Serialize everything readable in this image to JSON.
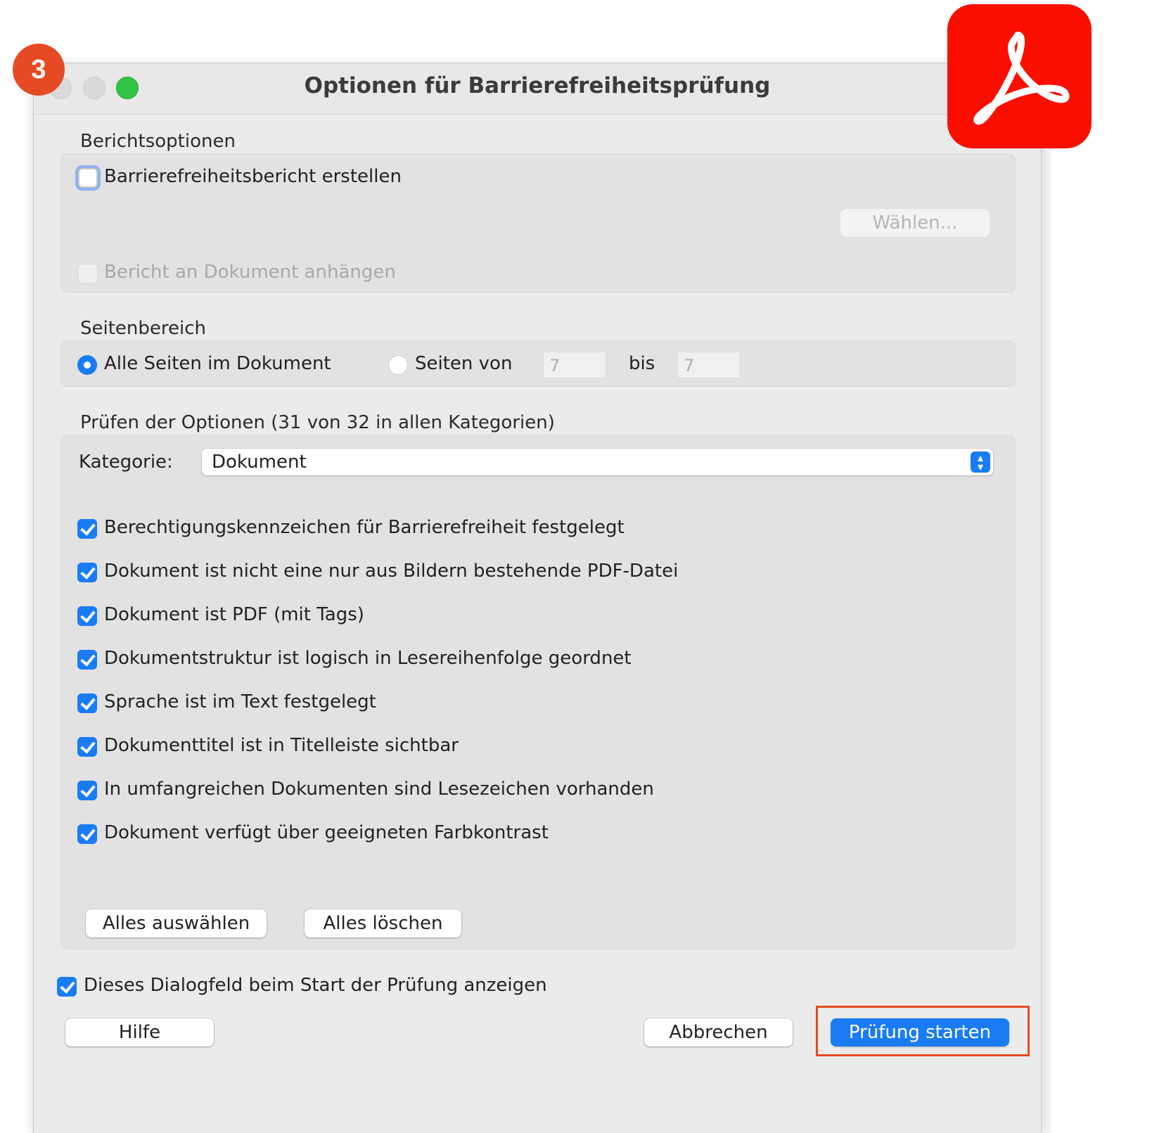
{
  "window": {
    "title": "Optionen für Barrierefreiheitsprüfung"
  },
  "step_badge": "3",
  "report_options": {
    "heading": "Berichtsoptionen",
    "create_report_label": "Barrierefreiheitsbericht erstellen",
    "create_report_checked": false,
    "choose_button": "Wählen...",
    "attach_report_label": "Bericht an Dokument anhängen",
    "attach_report_checked": false
  },
  "page_range": {
    "heading": "Seitenbereich",
    "all_pages_label": "Alle Seiten im Dokument",
    "all_pages_selected": true,
    "pages_from_label": "Seiten von",
    "from_value": "7",
    "to_label": "bis",
    "to_value": "7"
  },
  "check_options": {
    "heading": "Prüfen der Optionen (31 von 32 in allen Kategorien)",
    "category_label": "Kategorie:",
    "category_value": "Dokument",
    "items": [
      {
        "label": "Berechtigungskennzeichen für Barrierefreiheit festgelegt",
        "checked": true
      },
      {
        "label": "Dokument ist nicht eine nur aus Bildern bestehende PDF-Datei",
        "checked": true
      },
      {
        "label": "Dokument ist PDF (mit Tags)",
        "checked": true
      },
      {
        "label": "Dokumentstruktur ist logisch in Lesereihenfolge geordnet",
        "checked": true
      },
      {
        "label": "Sprache ist im Text festgelegt",
        "checked": true
      },
      {
        "label": "Dokumenttitel ist in Titelleiste sichtbar",
        "checked": true
      },
      {
        "label": "In umfangreichen Dokumenten sind Lesezeichen vorhanden",
        "checked": true
      },
      {
        "label": "Dokument verfügt über geeigneten Farbkontrast",
        "checked": true
      }
    ],
    "select_all_button": "Alles auswählen",
    "clear_all_button": "Alles löschen"
  },
  "show_dialog": {
    "label": "Dieses Dialogfeld beim Start der Prüfung anzeigen",
    "checked": true
  },
  "footer": {
    "help_button": "Hilfe",
    "cancel_button": "Abbrechen",
    "start_button": "Prüfung starten"
  },
  "colors": {
    "accent_blue": "#1a7cf5",
    "highlight_orange": "#e64b22",
    "acrobat_red": "#fa0f00"
  }
}
